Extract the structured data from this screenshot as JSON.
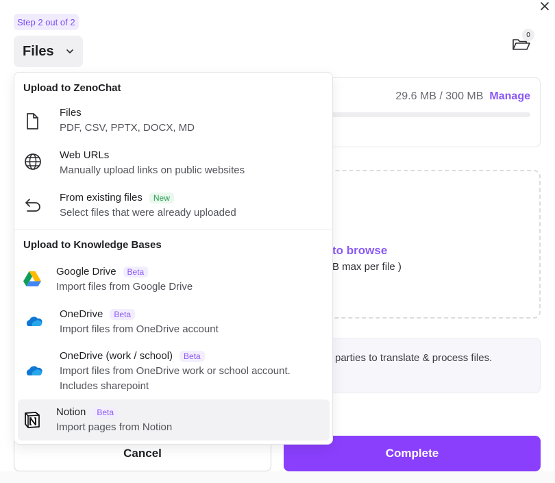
{
  "header": {
    "step_badge": "Step 2 out of 2",
    "files_dropdown_label": "Files",
    "folder_count": "0"
  },
  "storage": {
    "usage": "29.6 MB / 300 MB",
    "manage_label": "Manage",
    "used_fraction": 0.099
  },
  "upload_area": {
    "browse_text": "to browse",
    "limit_text": "B max per file )"
  },
  "notice": {
    "text": "parties to translate & process files."
  },
  "footer": {
    "cancel_label": "Cancel",
    "complete_label": "Complete"
  },
  "menu": {
    "section_zenochat": "Upload to ZenoChat",
    "section_kb": "Upload to Knowledge Bases",
    "zenochat_items": [
      {
        "title": "Files",
        "desc": "PDF, CSV, PPTX, DOCX, MD",
        "icon": "file-icon"
      },
      {
        "title": "Web URLs",
        "desc": "Manually upload links on public websites",
        "icon": "globe-icon"
      },
      {
        "title": "From existing files",
        "tag": "New",
        "desc": "Select files that were already uploaded",
        "icon": "return-arrow-icon"
      }
    ],
    "kb_items": [
      {
        "title": "Google Drive",
        "tag": "Beta",
        "desc": "Import files from Google Drive",
        "icon": "google-drive-icon"
      },
      {
        "title": "OneDrive",
        "tag": "Beta",
        "desc": "Import files from OneDrive account",
        "icon": "onedrive-icon"
      },
      {
        "title": "OneDrive (work / school)",
        "tag": "Beta",
        "desc": "Import files from OneDrive work or school account. Includes sharepoint",
        "icon": "onedrive-icon"
      },
      {
        "title": "Notion",
        "tag": "Beta",
        "desc": "Import pages from Notion",
        "icon": "notion-icon"
      }
    ]
  },
  "colors": {
    "accent": "#8a3ffc",
    "accent_text": "#8a58f5",
    "badge_bg": "#f1ecfd"
  }
}
